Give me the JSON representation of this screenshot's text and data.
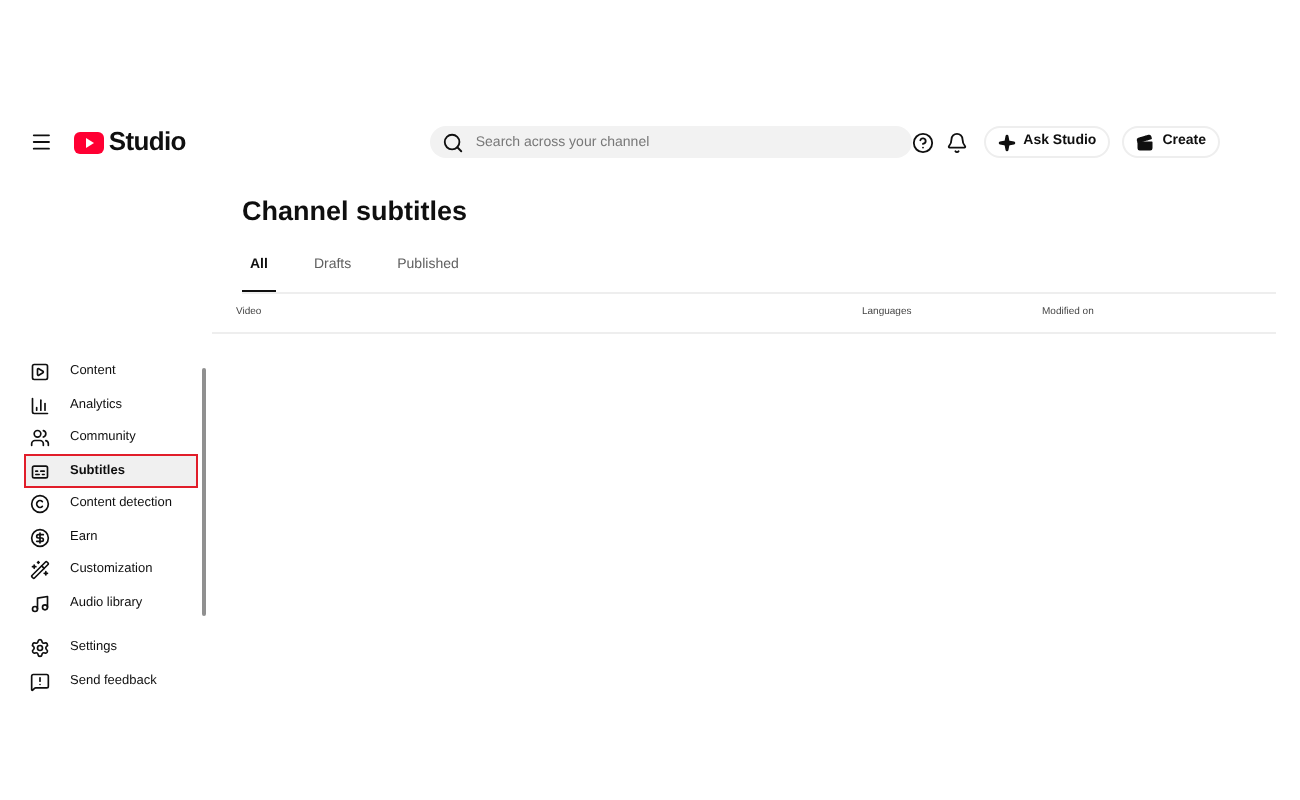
{
  "header": {
    "logo_text": "Studio",
    "search": {
      "placeholder": "Search across your channel"
    },
    "buttons": [
      {
        "kind": "ask",
        "label": "Ask Studio"
      },
      {
        "kind": "create",
        "label": "Create"
      }
    ]
  },
  "sidebar": {
    "items": [
      {
        "kind": "content",
        "label": "Content",
        "selected": false,
        "highlighted": false
      },
      {
        "kind": "analytics",
        "label": "Analytics",
        "selected": false,
        "highlighted": false
      },
      {
        "kind": "community",
        "label": "Community",
        "selected": false,
        "highlighted": false
      },
      {
        "kind": "subtitles",
        "label": "Subtitles",
        "selected": true,
        "highlighted": true
      },
      {
        "kind": "detection",
        "label": "Content detection",
        "selected": false,
        "highlighted": false
      },
      {
        "kind": "earn",
        "label": "Earn",
        "selected": false,
        "highlighted": false
      },
      {
        "kind": "customization",
        "label": "Customization",
        "selected": false,
        "highlighted": false
      },
      {
        "kind": "audio",
        "label": "Audio library",
        "selected": false,
        "highlighted": false
      }
    ],
    "footer_items": [
      {
        "kind": "settings",
        "label": "Settings"
      },
      {
        "kind": "feedback",
        "label": "Send feedback"
      }
    ]
  },
  "page": {
    "title": "Channel subtitles",
    "tabs": [
      {
        "label": "All",
        "selected": true
      },
      {
        "label": "Drafts",
        "selected": false
      },
      {
        "label": "Published",
        "selected": false
      }
    ],
    "table": {
      "columns": [
        "Video",
        "Languages",
        "Modified on"
      ]
    }
  }
}
